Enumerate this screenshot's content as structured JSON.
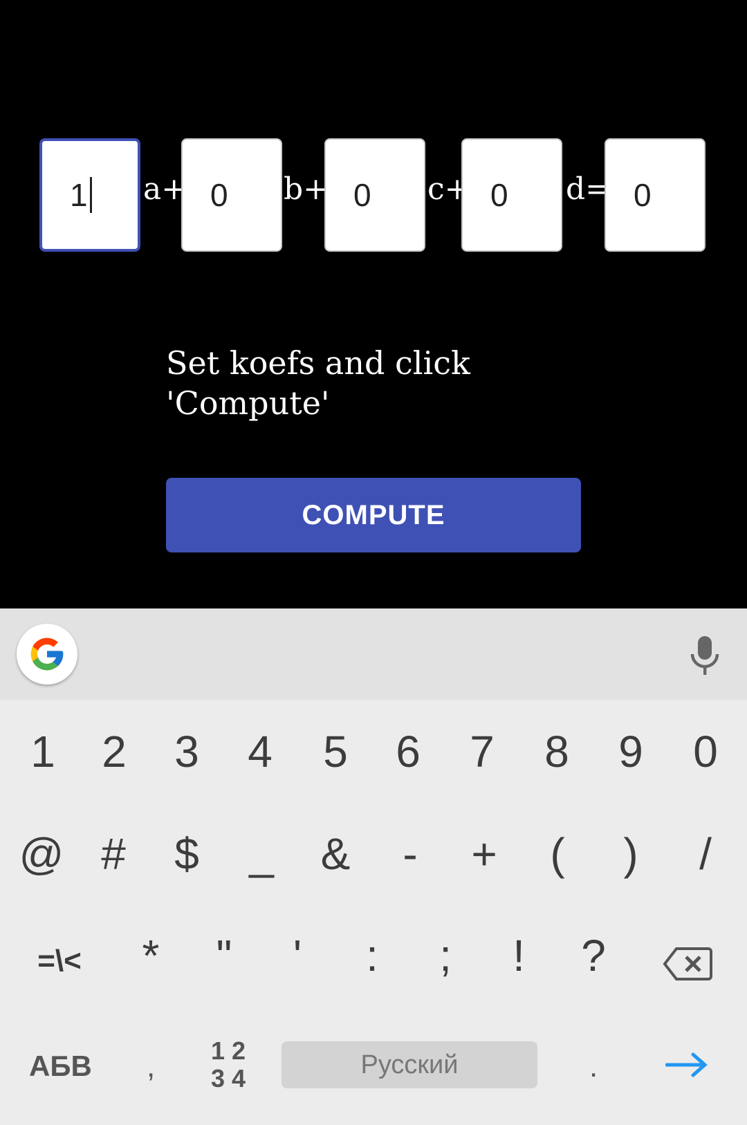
{
  "equation": {
    "fields": [
      {
        "value": "1",
        "focused": true
      },
      {
        "value": "0",
        "focused": false
      },
      {
        "value": "0",
        "focused": false
      },
      {
        "value": "0",
        "focused": false
      },
      {
        "value": "0",
        "focused": false
      }
    ],
    "operators": [
      "a+",
      "b+",
      "c+",
      "d="
    ]
  },
  "hint": "Set koefs and click 'Compute'",
  "compute_label": "COMPUTE",
  "colors": {
    "accent": "#3f51b5",
    "background": "#000000",
    "keyboard": "#ececec"
  },
  "keyboard": {
    "row1": [
      "1",
      "2",
      "3",
      "4",
      "5",
      "6",
      "7",
      "8",
      "9",
      "0"
    ],
    "row2": [
      "@",
      "#",
      "$",
      "_",
      "&",
      "-",
      "+",
      "(",
      ")",
      "/"
    ],
    "row3": [
      "=\\<",
      "*",
      "\"",
      "'",
      ":",
      ";",
      "!",
      "?"
    ],
    "backspace_icon": "backspace-icon",
    "abc_label": "АБВ",
    "comma": ",",
    "numpad_top": "1 2",
    "numpad_bottom": "3 4",
    "space_label": "Русский",
    "period": ".",
    "enter_icon": "arrow-right-icon",
    "google_icon": "google-g-icon",
    "mic_icon": "microphone-icon"
  }
}
